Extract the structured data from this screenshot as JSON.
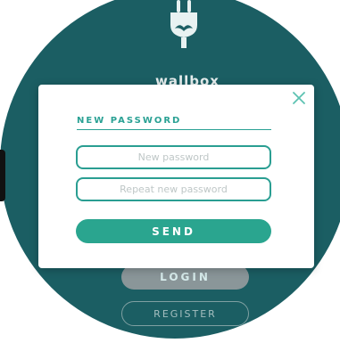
{
  "brand": {
    "name": "wallbox",
    "logo_icon": "plug-icon"
  },
  "background": {
    "buttons": {
      "login_label": "LOGIN",
      "register_label": "REGISTER"
    }
  },
  "modal": {
    "title": "NEW PASSWORD",
    "close_icon": "close-icon",
    "fields": {
      "new_password": {
        "value": "",
        "placeholder": "New password"
      },
      "repeat_password": {
        "value": "",
        "placeholder": "Repeat new password"
      }
    },
    "send_label": "SEND"
  },
  "colors": {
    "accent": "#2aa58f",
    "background_circle": "#1b5e63",
    "login_button": "#8a9699"
  }
}
